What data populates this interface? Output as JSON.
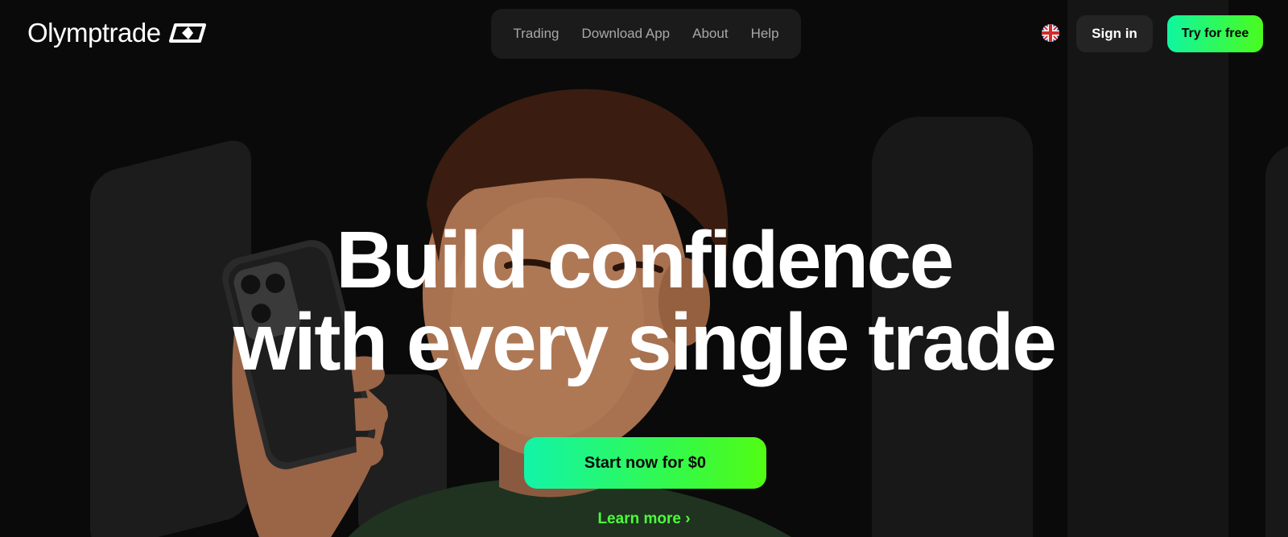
{
  "brand": {
    "name": "Olymptrade"
  },
  "nav": {
    "items": [
      "Trading",
      "Download App",
      "About",
      "Help"
    ]
  },
  "header": {
    "language_icon": "uk-flag-icon",
    "signin_label": "Sign in",
    "try_label": "Try for free"
  },
  "hero": {
    "headline_line1": "Build confidence",
    "headline_line2": "with every single trade",
    "cta_label": "Start now for $0",
    "learn_more_label": "Learn more ›"
  },
  "colors": {
    "accent_start": "#10f5a0",
    "accent_end": "#4afc1d",
    "background": "#0a0a0a",
    "learn_more": "#4cff3a"
  }
}
